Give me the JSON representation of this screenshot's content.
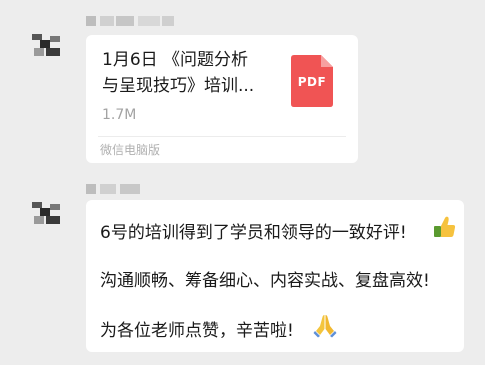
{
  "chat": {
    "messages": [
      {
        "type": "file",
        "file_title_line1": "1月6日 《问题分析",
        "file_title_line2": "与呈现技巧》培训...",
        "file_size": "1.7M",
        "file_type_label": "PDF",
        "source": "微信电脑版",
        "accent_color": "#f05454",
        "icon": "pdf-file-icon"
      },
      {
        "type": "text",
        "lines": [
          "6号的培训得到了学员和领导的一致好评!",
          "沟通顺畅、筹备细心、内容实战、复盘高效!",
          "为各位老师点赞，辛苦啦!"
        ],
        "emojis": [
          "thumbs-up-icon",
          "folded-hands-icon"
        ]
      }
    ]
  }
}
